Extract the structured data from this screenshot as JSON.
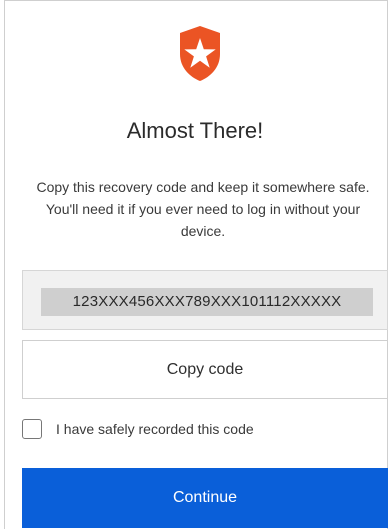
{
  "brand": {
    "logo_icon": "auth0-shield-star-icon",
    "logo_color": "#eb5424"
  },
  "title": "Almost There!",
  "description": "Copy this recovery code and keep it somewhere safe. You'll need it if you ever need to log in without your device.",
  "recovery_code": "123XXX456XXX789XXX101112XXXXX",
  "copy_button_label": "Copy code",
  "confirm_checkbox": {
    "label": "I have safely recorded this code",
    "checked": false
  },
  "continue_button_label": "Continue",
  "colors": {
    "primary": "#0a5fd9",
    "code_background": "#f1f1f1"
  }
}
